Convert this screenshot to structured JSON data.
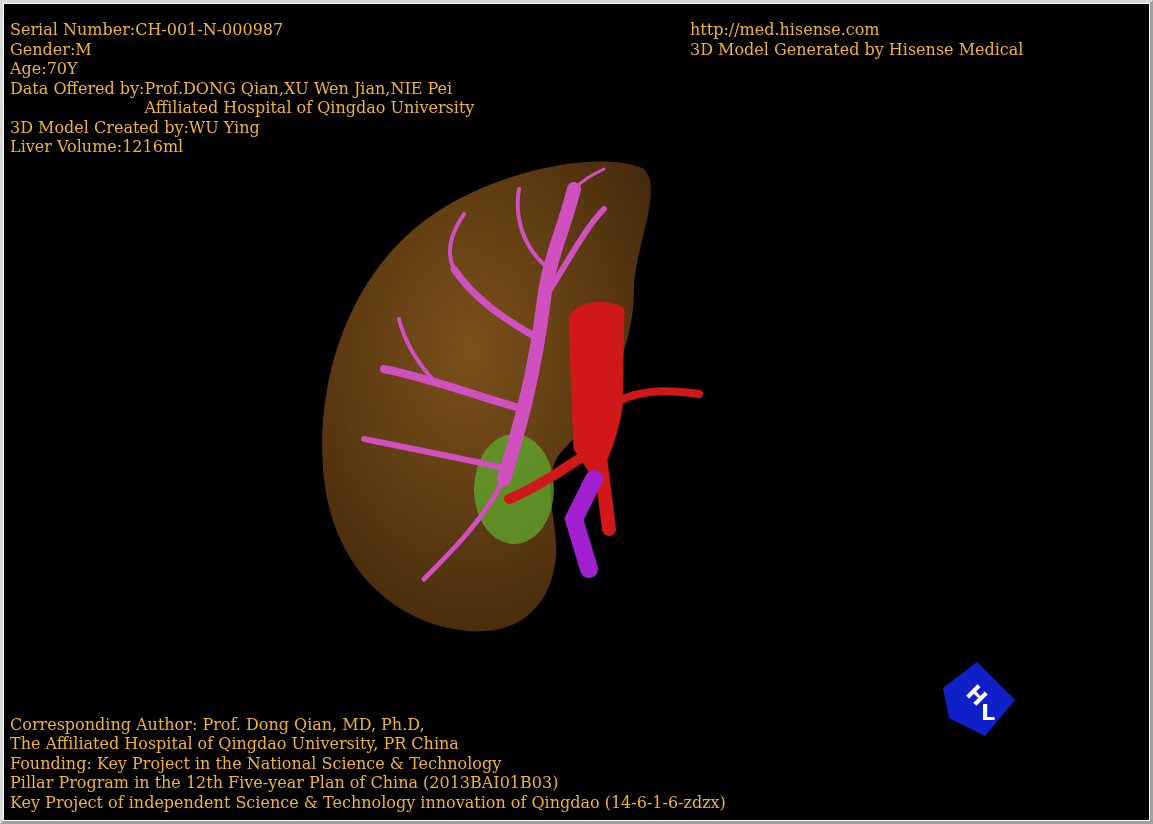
{
  "info_lines": [
    "Serial Number:CH-001-N-000987",
    "Gender:M",
    "Age:70Y"
  ],
  "data_offered": {
    "label": "Data Offered by:",
    "values": [
      "Prof.DONG Qian,XU Wen Jian,NIE Pei",
      "Affiliated Hospital of Qingdao University"
    ]
  },
  "info_lines_after": [
    "3D Model Created by:WU Ying",
    "Liver Volume:1216ml"
  ],
  "header_right": [
    "http://med.hisense.com",
    "3D Model Generated by Hisense Medical"
  ],
  "credits": [
    "Corresponding Author: Prof. Dong Qian, MD, Ph.D,",
    "The Affiliated Hospital of Qingdao University, PR China",
    "Founding: Key Project in the National Science & Technology",
    "Pillar Program in the 12th Five-year Plan of China (2013BAI01B03)",
    "Key Project of independent Science & Technology innovation of Qingdao (14-6-1-6-zdzx)"
  ],
  "orientation_cube": {
    "labels": [
      "H",
      "L"
    ]
  }
}
